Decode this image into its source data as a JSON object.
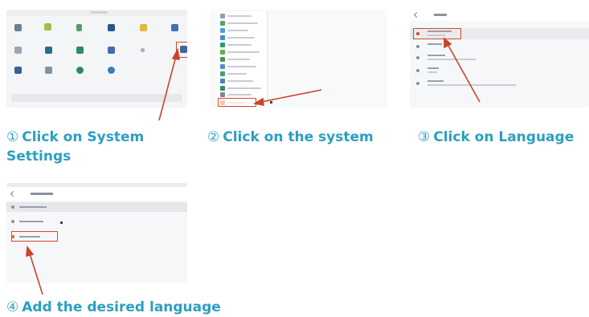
{
  "steps": [
    {
      "number": "①",
      "text": "Click on System",
      "text_line2": "Settings"
    },
    {
      "number": "②",
      "text": "Click on the system"
    },
    {
      "number": "③",
      "text": "Click on Language"
    },
    {
      "number": "④",
      "text": "Add the desired language"
    }
  ],
  "colors": {
    "caption": "#2b9fc1",
    "highlight": "#d8472e",
    "arrow": "#c9442c"
  },
  "icons": [
    "app-grid-icon",
    "settings-app-icon",
    "arrow-pointer-icon",
    "back-arrow-icon",
    "cursor-icon"
  ]
}
